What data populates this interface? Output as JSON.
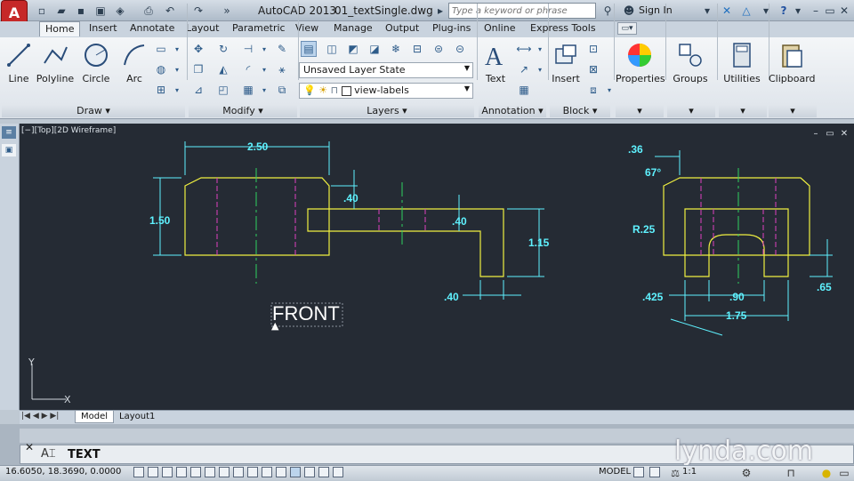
{
  "app": {
    "title": "AutoCAD 2013",
    "file": "01_textSingle.dwg",
    "logo": "A"
  },
  "search": {
    "placeholder": "Type a keyword or phrase"
  },
  "account": {
    "signin": "Sign In"
  },
  "tabs": [
    "Home",
    "Insert",
    "Annotate",
    "Layout",
    "Parametric",
    "View",
    "Manage",
    "Output",
    "Plug-ins",
    "Online",
    "Express Tools"
  ],
  "ribbon": {
    "draw": {
      "title": "Draw",
      "line": "Line",
      "polyline": "Polyline",
      "circle": "Circle",
      "arc": "Arc"
    },
    "modify": {
      "title": "Modify"
    },
    "layers": {
      "title": "Layers",
      "layer_state": "Unsaved Layer State",
      "current_layer": "view-labels"
    },
    "annotation": {
      "title": "Annotation",
      "text": "Text"
    },
    "block": {
      "title": "Block",
      "insert": "Insert"
    },
    "properties": {
      "label": "Properties"
    },
    "groups": {
      "label": "Groups"
    },
    "utilities": {
      "label": "Utilities"
    },
    "clipboard": {
      "label": "Clipboard"
    }
  },
  "viewport": {
    "label": "[−][Top][2D Wireframe]"
  },
  "drawing": {
    "mtext": "FRONT",
    "dims": {
      "d1": "2.50",
      "d2": "1.50",
      "d3": ".40",
      "d4": ".40",
      "d5": "1.15",
      "d6": ".40",
      "d7": ".36",
      "d8": "67°",
      "d9": "R.25",
      "d10": ".425",
      "d11": ".90",
      "d12": ".65",
      "d13": "1.75"
    },
    "ucs_x": "X",
    "ucs_y": "Y"
  },
  "layout_tabs": [
    "Model",
    "Layout1"
  ],
  "command": {
    "text": "TEXT",
    "prompt_icon": "A⌶"
  },
  "status": {
    "coords": "16.6050, 18.3690, 0.0000",
    "model": "MODEL",
    "scale": "1:1"
  },
  "watermark": "lynda.com",
  "colors": {
    "geometry": "#f0f040",
    "dimension": "#5ff2ff",
    "centerline": "#30d060",
    "hidden": "#e040c0",
    "background": "#252b34"
  }
}
